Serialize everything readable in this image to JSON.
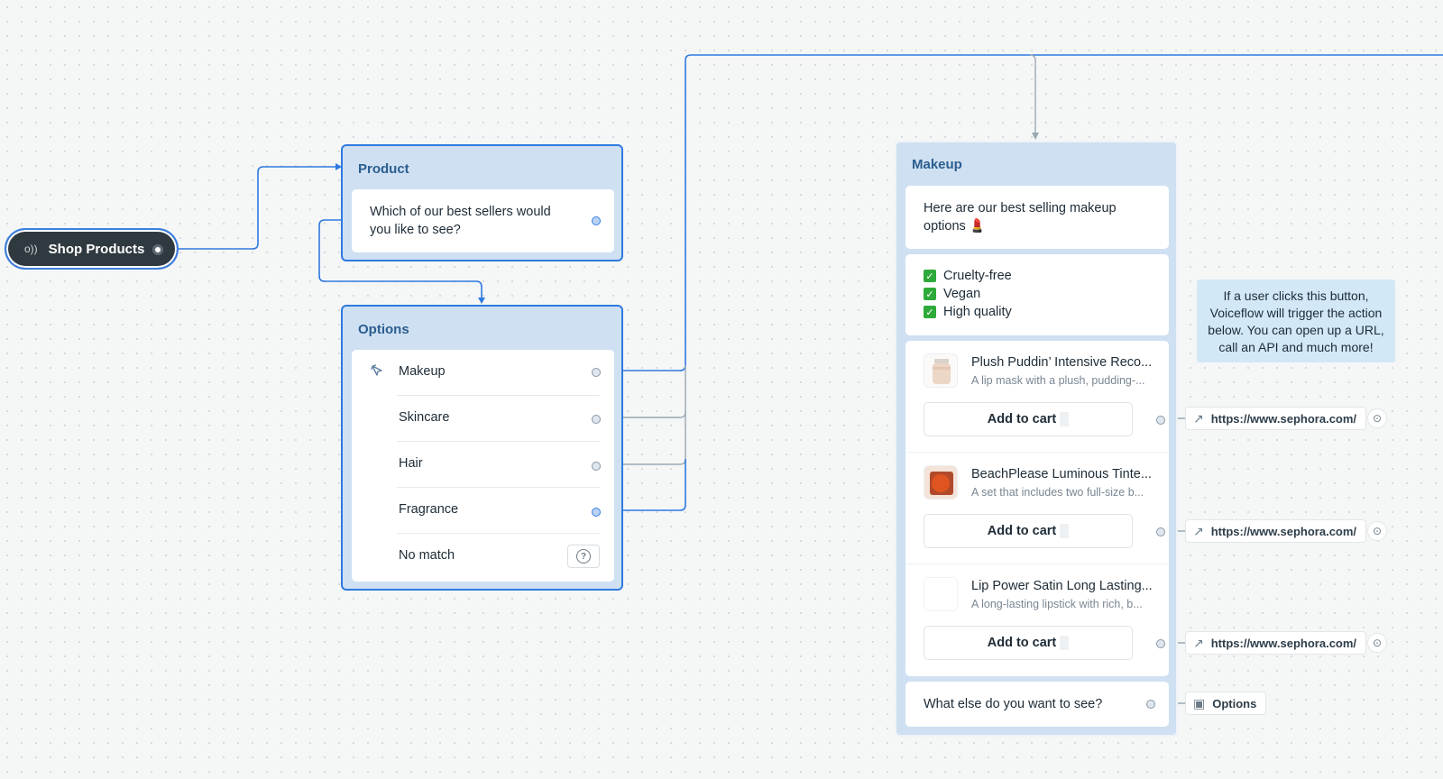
{
  "start": {
    "label": "Shop Products",
    "icon": "o))"
  },
  "product_block": {
    "title": "Product",
    "speak_line1": "Which of our best sellers would",
    "speak_line2": "you like to see?"
  },
  "options_block": {
    "title": "Options",
    "choices": [
      {
        "label": "Makeup"
      },
      {
        "label": "Skincare"
      },
      {
        "label": "Hair"
      },
      {
        "label": "Fragrance"
      },
      {
        "label": "No match"
      }
    ],
    "help_glyph": "?"
  },
  "makeup_block": {
    "title": "Makeup",
    "intro_line1": "Here are our best selling makeup",
    "intro_line2": "options 💄",
    "checks": [
      "Cruelty-free",
      "Vegan",
      "High quality"
    ],
    "check_glyph": "✓",
    "products": [
      {
        "name": "Plush Puddin’ Intensive Reco...",
        "desc": "A lip mask with a plush, pudding-...",
        "button": "Add to cart"
      },
      {
        "name": "BeachPlease Luminous Tinte...",
        "desc": "A set that includes two full-size b...",
        "button": "Add to cart"
      },
      {
        "name": "Lip Power Satin Long Lasting...",
        "desc": "A long-lasting lipstick with rich, b...",
        "button": "Add to cart"
      }
    ],
    "followup": "What else do you want to see?"
  },
  "actions": {
    "urls": [
      "https://www.sephora.com/",
      "https://www.sephora.com/",
      "https://www.sephora.com/"
    ],
    "goto_label": "Options",
    "link_icon": "↗",
    "goto_icon": "▣",
    "play_icon": "⊙"
  },
  "note": {
    "text": "If a user clicks this button, Voiceflow will trigger the action below. You can open up a URL, call an API and much more!"
  },
  "colors": {
    "canvas": "#f5f6f6",
    "block": "#cfe0f2",
    "accent": "#2e7ae0",
    "start_node": "#2f3a40",
    "note": "#d2e8f7",
    "check": "#2eaa3a"
  }
}
